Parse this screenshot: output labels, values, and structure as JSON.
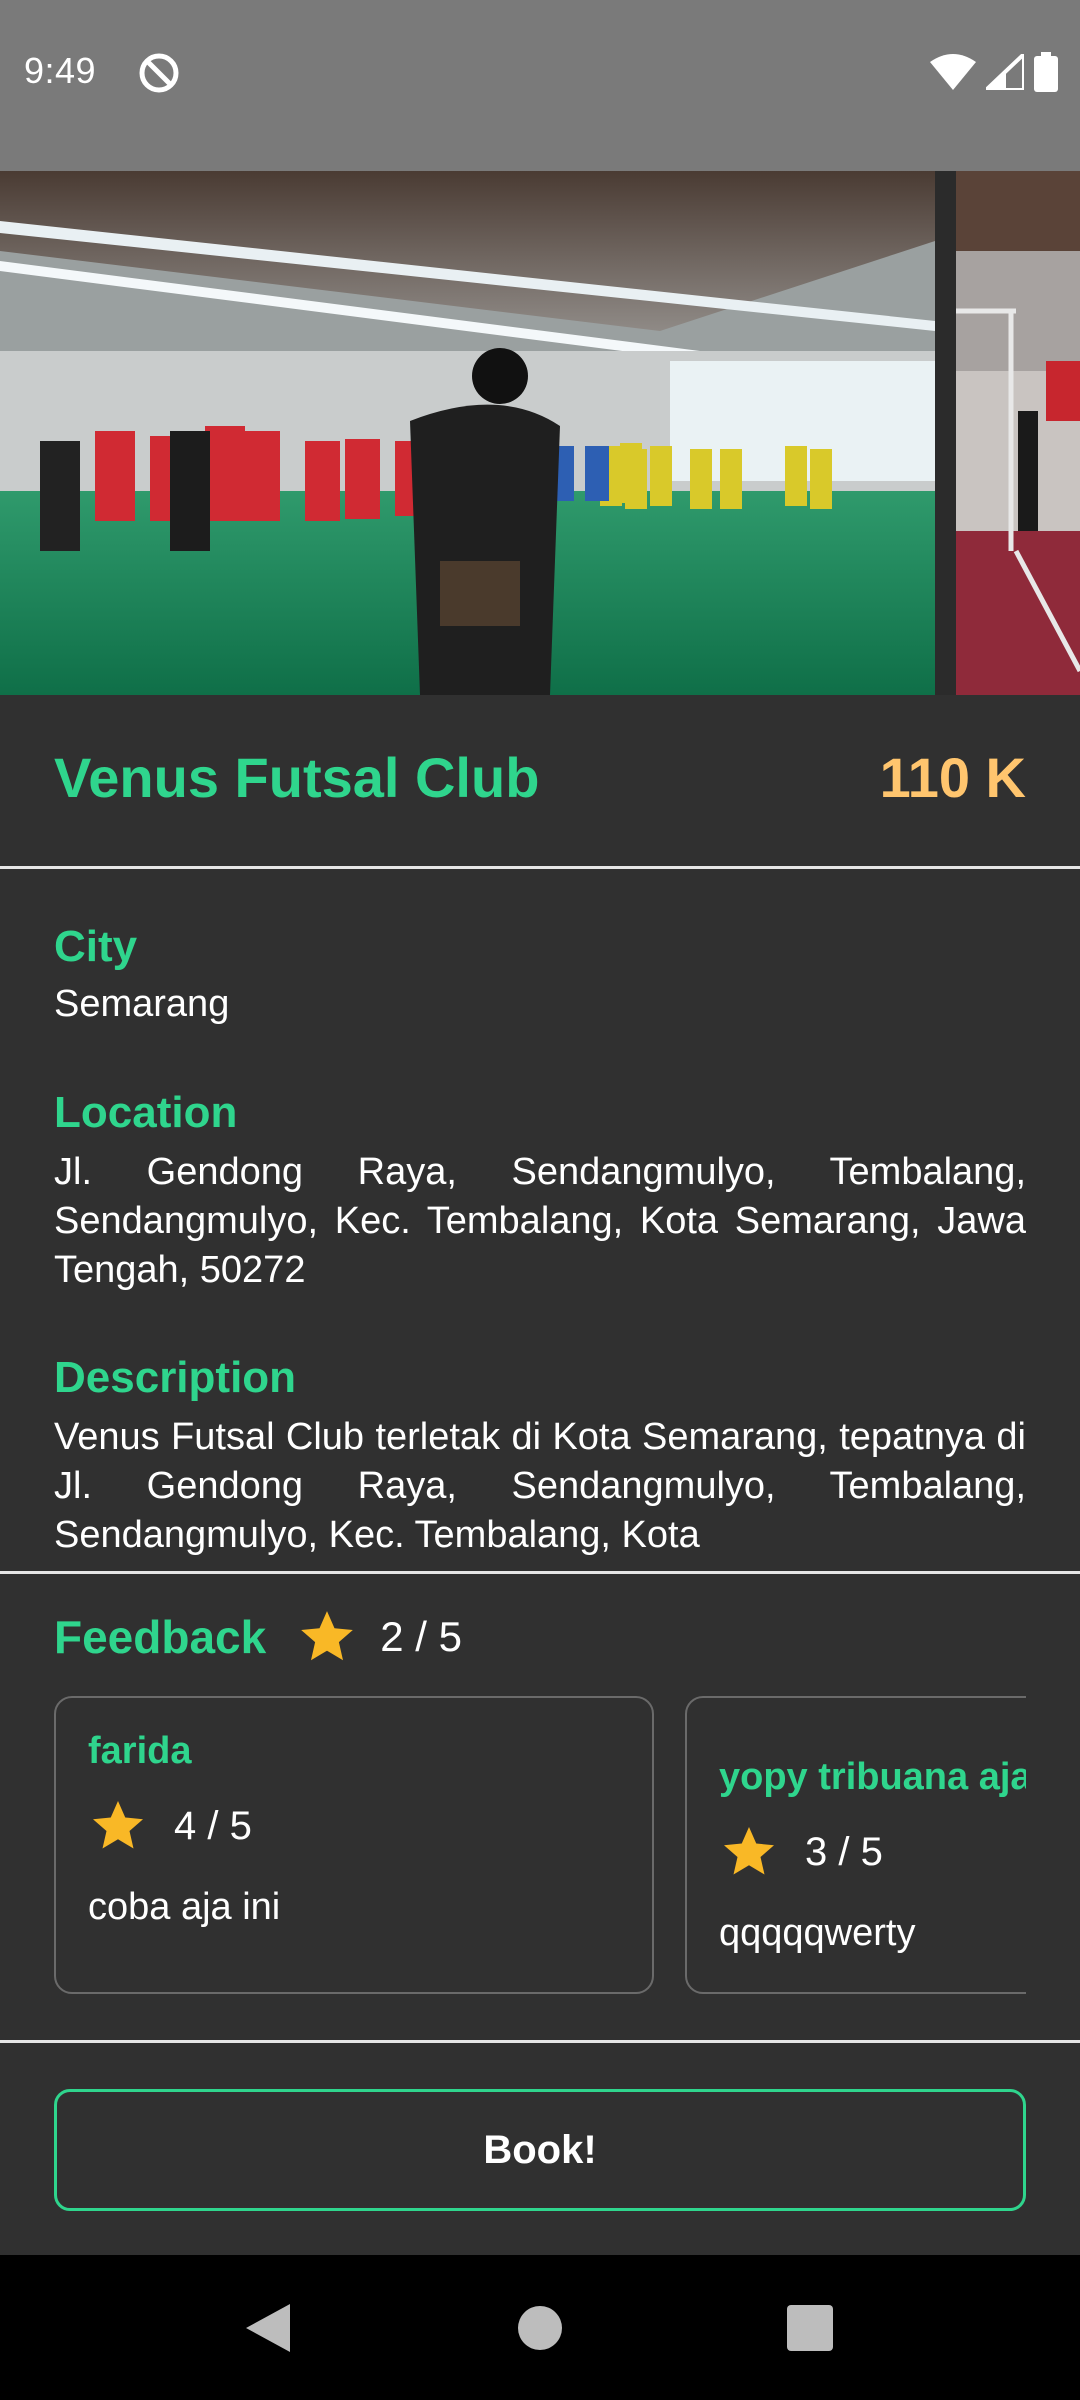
{
  "status_bar": {
    "time": "9:49",
    "icons": [
      "do-not-disturb-icon",
      "wifi-icon",
      "cell-signal-icon",
      "battery-icon"
    ]
  },
  "gallery": {
    "images": [
      "futsal-hall-team-photo",
      "futsal-goal-photo"
    ]
  },
  "venue": {
    "name": "Venus Futsal Club",
    "price": "110 K"
  },
  "details": {
    "city_label": "City",
    "city": "Semarang",
    "location_label": "Location",
    "location": "Jl. Gendong Raya, Sendangmulyo, Tembalang, Sendangmulyo, Kec. Tembalang, Kota Semarang, Jawa Tengah, 50272",
    "description_label": "Description",
    "description": "Venus Futsal Club terletak di Kota Semarang, tepatnya di Jl. Gendong Raya, Sendangmulyo, Tembalang, Sendangmulyo, Kec. Tembalang, Kota"
  },
  "feedback": {
    "title": "Feedback",
    "rating": "2 / 5",
    "reviews": [
      {
        "name": "farida",
        "rating": "4 / 5",
        "text": "coba aja ini"
      },
      {
        "name": "yopy tribuana aja",
        "rating": "3 / 5",
        "text": "qqqqqwerty"
      }
    ]
  },
  "book_button": {
    "label": "Book!"
  },
  "colors": {
    "accent": "#2fd58d",
    "price": "#ffc56e",
    "star": "#f9b826",
    "background": "#303030"
  },
  "nav_bar": {
    "icons": [
      "back-icon",
      "home-icon",
      "recents-icon"
    ]
  }
}
